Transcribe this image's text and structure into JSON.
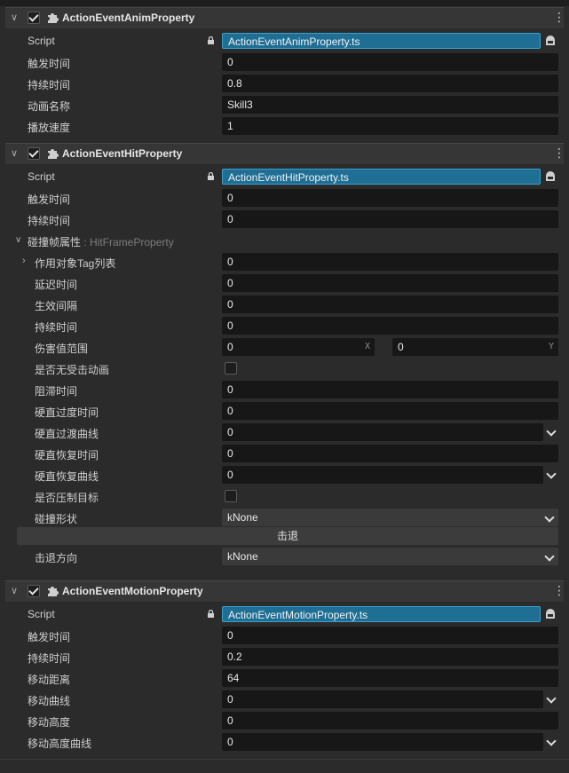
{
  "panels": [
    {
      "title": "ActionEventAnimProperty",
      "script_label": "Script",
      "script_value": "ActionEventAnimProperty.ts",
      "rows": [
        {
          "label": "触发时间",
          "value": "0"
        },
        {
          "label": "持续时间",
          "value": "0.8"
        },
        {
          "label": "动画名称",
          "value": "Skill3"
        },
        {
          "label": "播放速度",
          "value": "1"
        }
      ]
    },
    {
      "title": "ActionEventHitProperty",
      "script_label": "Script",
      "script_value": "ActionEventHitProperty.ts",
      "rows": [
        {
          "label": "触发时间",
          "value": "0"
        },
        {
          "label": "持续时间",
          "value": "0"
        }
      ],
      "group": {
        "label": "碰撞帧属性",
        "type": " : HitFrameProperty",
        "rows": [
          {
            "label": "作用对象Tag列表",
            "value": "0"
          },
          {
            "label": "延迟时间",
            "value": "0"
          },
          {
            "label": "生效间隔",
            "value": "0"
          },
          {
            "label": "持续时间",
            "value": "0"
          },
          {
            "label": "伤害值范围",
            "x": "0",
            "y": "0",
            "x_axis": "X",
            "y_axis": "Y"
          },
          {
            "label": "是否无受击动画",
            "checked": false
          },
          {
            "label": "阻滞时间",
            "value": "0"
          },
          {
            "label": "硬直过度时间",
            "value": "0"
          },
          {
            "label": "硬直过渡曲线",
            "value": "0"
          },
          {
            "label": "硬直恢复时间",
            "value": "0"
          },
          {
            "label": "硬直恢复曲线",
            "value": "0"
          },
          {
            "label": "是否压制目标",
            "checked": false
          },
          {
            "label": "碰撞形状",
            "value": "kNone"
          }
        ],
        "hit_button": "击退",
        "after_rows": [
          {
            "label": "击退方向",
            "value": "kNone"
          }
        ]
      }
    },
    {
      "title": "ActionEventMotionProperty",
      "script_label": "Script",
      "script_value": "ActionEventMotionProperty.ts",
      "rows": [
        {
          "label": "触发时间",
          "value": "0"
        },
        {
          "label": "持续时间",
          "value": "0.2"
        },
        {
          "label": "移动距离",
          "value": "64"
        },
        {
          "label": "移动曲线",
          "value": "0"
        },
        {
          "label": "移动高度",
          "value": "0"
        },
        {
          "label": "移动高度曲线",
          "value": "0"
        }
      ]
    }
  ],
  "colors": {
    "background": "#2b2b2b",
    "header": "#363636",
    "field": "#171717",
    "script_field": "#1f6f95"
  },
  "icons": {
    "expand": "chevron-down-icon",
    "component": "puzzle-icon",
    "menu": "more-vertical-icon",
    "lock": "lock-icon",
    "script_open": "folder-icon"
  }
}
